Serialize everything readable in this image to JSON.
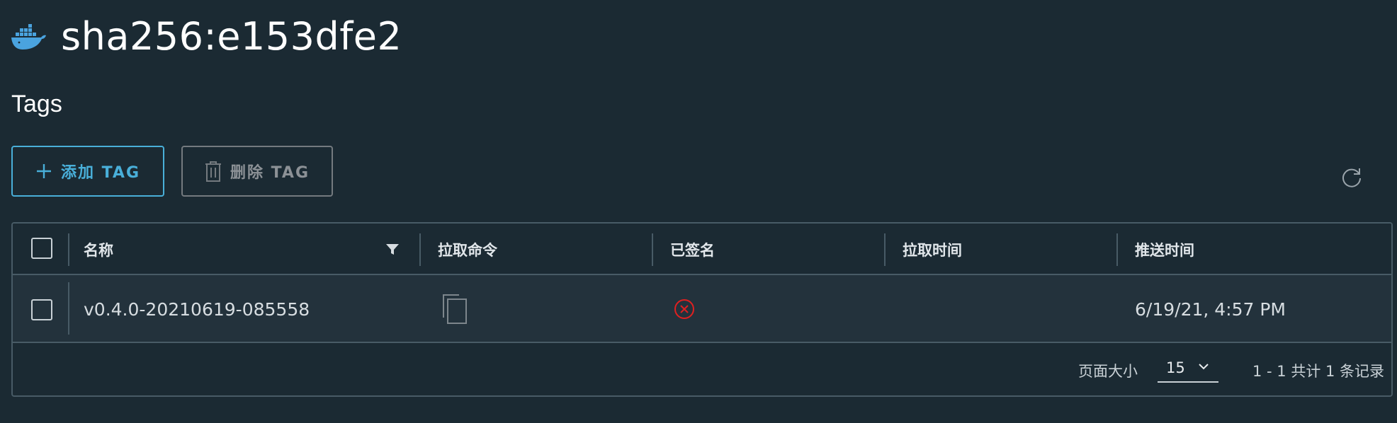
{
  "header": {
    "title": "sha256:e153dfe2",
    "logo_icon": "docker-whale-icon"
  },
  "section": {
    "title": "Tags"
  },
  "toolbar": {
    "add_label": "添加 TAG",
    "add_icon": "plus-icon",
    "delete_label": "删除 TAG",
    "delete_icon": "trash-icon",
    "refresh_icon": "refresh-icon"
  },
  "table": {
    "columns": [
      "名称",
      "拉取命令",
      "已签名",
      "拉取时间",
      "推送时间"
    ],
    "filter_icon": "filter-icon",
    "rows": [
      {
        "name": "v0.4.0-20210619-085558",
        "pull_command_icon": "copy-icon",
        "signed_icon": "error-circle-icon",
        "signed": false,
        "pull_time": "",
        "push_time": "6/19/21, 4:57 PM"
      }
    ]
  },
  "footer": {
    "page_size_label": "页面大小",
    "page_size_value": "15",
    "summary": "1 - 1 共计 1 条记录"
  },
  "colors": {
    "background": "#1b2a33",
    "accent": "#49afd9",
    "disabled": "#8c9196",
    "error": "#e02020",
    "border": "#485b66"
  }
}
